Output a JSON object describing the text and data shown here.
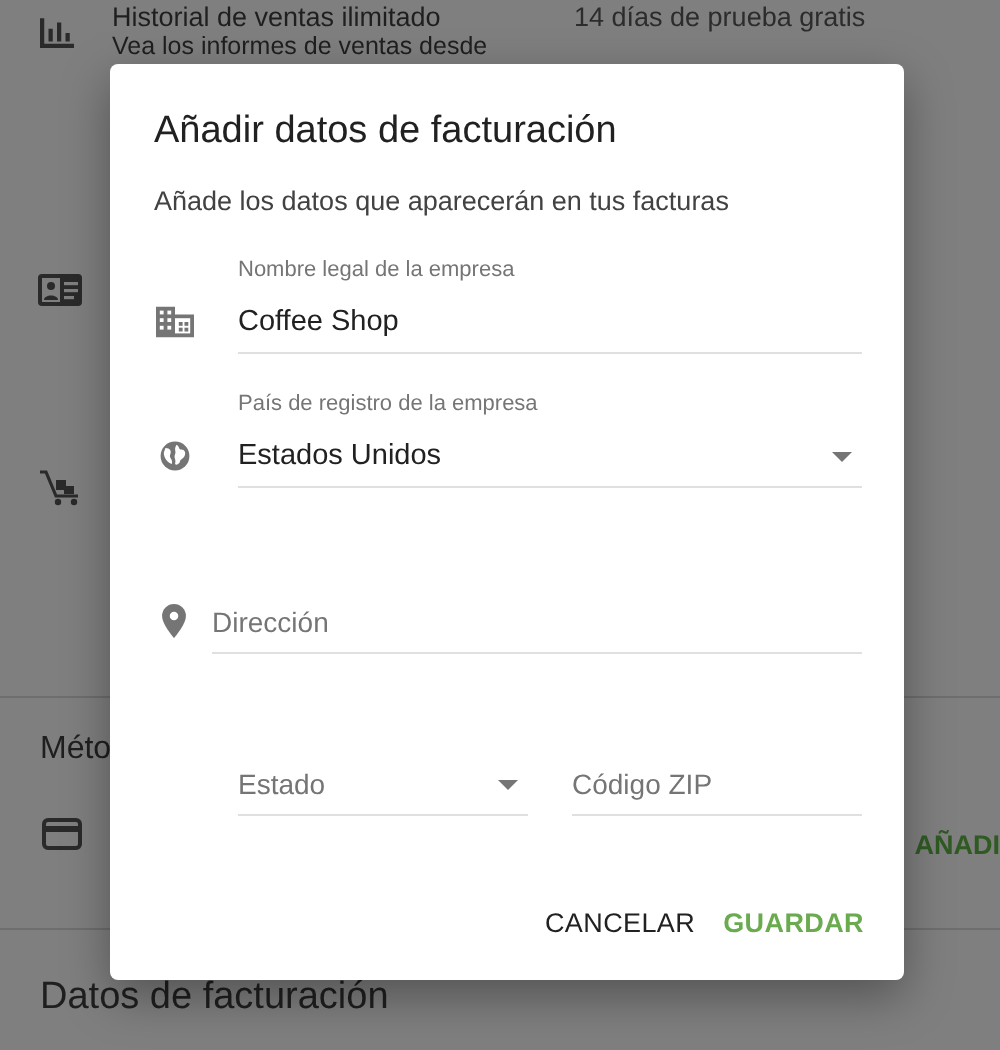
{
  "page": {
    "feature": {
      "title": "Historial de ventas ilimitado",
      "description": "Vea los informes de ventas desde",
      "trial": "14 días de prueba gratis"
    },
    "payment_section_title": "Méto",
    "add_button": "AÑADI",
    "billing_title": "Datos de facturación"
  },
  "dialog": {
    "title": "Añadir datos de facturación",
    "subtitle": "Añade los datos que aparecerán en tus facturas",
    "rows": [
      {
        "fields": [
          {
            "kind": "text",
            "label": "Nombre legal de la empresa",
            "value": "Coffee Shop"
          }
        ]
      },
      {
        "fields": [
          {
            "kind": "select",
            "label": "País de registro de la empresa",
            "value": "Estados Unidos"
          }
        ]
      },
      {
        "fields": [
          {
            "kind": "text",
            "placeholder": "Dirección"
          }
        ]
      },
      {
        "fields": [
          {
            "kind": "select",
            "placeholder": "Estado"
          },
          {
            "kind": "text",
            "placeholder": "Código ZIP"
          }
        ]
      }
    ],
    "buttons": [
      {
        "label": "CANCELAR",
        "kind": "plain"
      },
      {
        "label": "GUARDAR",
        "kind": "primary"
      }
    ]
  }
}
